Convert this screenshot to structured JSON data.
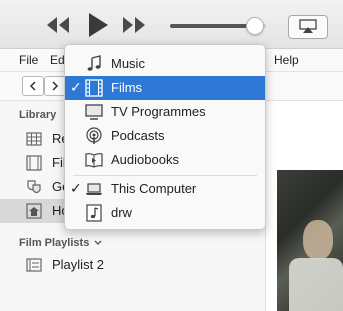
{
  "menubar": {
    "file": "File",
    "edit": "Edi",
    "help": "Help"
  },
  "sidebar": {
    "library_title": "Library",
    "items": [
      {
        "label": "Re",
        "icon": "grid-icon"
      },
      {
        "label": "Fil",
        "icon": "film-icon"
      },
      {
        "label": "Ge",
        "icon": "masks-icon"
      },
      {
        "label": "Ho",
        "icon": "house-icon"
      }
    ],
    "playlists_title": "Film Playlists",
    "playlists": [
      {
        "label": "Playlist 2",
        "icon": "playlist-film-icon"
      }
    ]
  },
  "dropdown": {
    "items": [
      {
        "label": "Music",
        "icon": "music-note-icon",
        "checked": false,
        "highlighted": false
      },
      {
        "label": "Films",
        "icon": "film-icon",
        "checked": true,
        "highlighted": true
      },
      {
        "label": "TV Programmes",
        "icon": "tv-icon",
        "checked": false,
        "highlighted": false
      },
      {
        "label": "Podcasts",
        "icon": "podcast-icon",
        "checked": false,
        "highlighted": false
      },
      {
        "label": "Audiobooks",
        "icon": "audiobook-icon",
        "checked": false,
        "highlighted": false
      },
      {
        "label": "This Computer",
        "icon": "laptop-icon",
        "checked": true,
        "highlighted": false
      },
      {
        "label": "drw",
        "icon": "music-file-icon",
        "checked": false,
        "highlighted": false
      }
    ],
    "checkmark": "✓"
  },
  "volume_level": 0.88,
  "colors": {
    "highlight": "#2f78d6"
  }
}
